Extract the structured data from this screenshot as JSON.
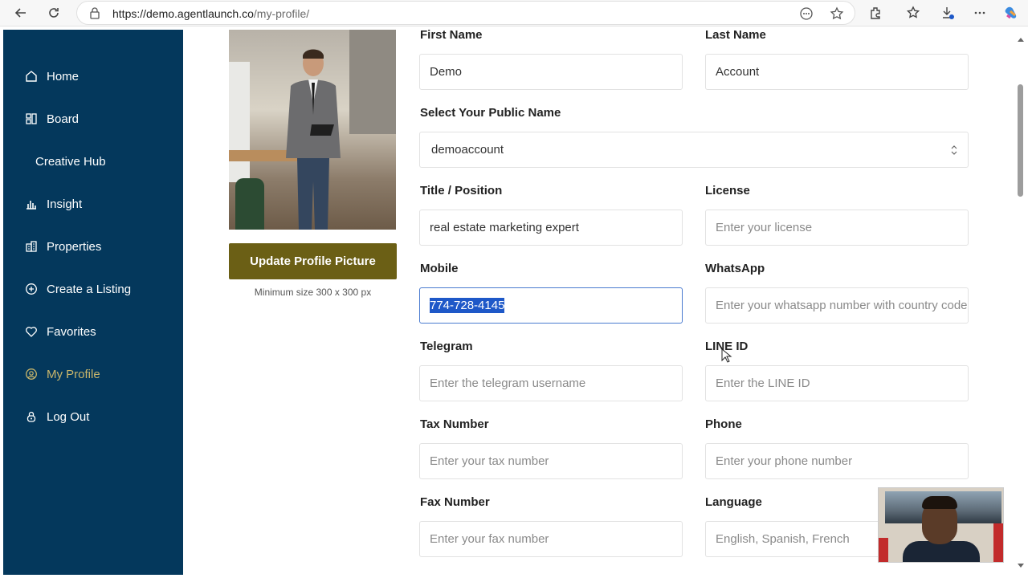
{
  "browser": {
    "url_host": "https://demo.agentlaunch.co",
    "url_path": "/my-profile/"
  },
  "sidebar": {
    "items": [
      {
        "label": "Home",
        "icon": "home-icon"
      },
      {
        "label": "Board",
        "icon": "board-icon"
      },
      {
        "label": "Creative Hub",
        "icon": ""
      },
      {
        "label": "Insight",
        "icon": "chart-icon"
      },
      {
        "label": "Properties",
        "icon": "building-icon"
      },
      {
        "label": "Create a Listing",
        "icon": "plus-circle-icon"
      },
      {
        "label": "Favorites",
        "icon": "heart-icon"
      },
      {
        "label": "My Profile",
        "icon": "user-circle-icon",
        "active": true
      },
      {
        "label": "Log Out",
        "icon": "lock-icon"
      }
    ],
    "active_color": "#c9b66b",
    "background": "#04385c"
  },
  "profile": {
    "update_button": "Update Profile Picture",
    "min_size_note": "Minimum size 300 x 300 px"
  },
  "form": {
    "first_name": {
      "label": "First Name",
      "value": "Demo"
    },
    "last_name": {
      "label": "Last Name",
      "value": "Account"
    },
    "public_name": {
      "label": "Select Your Public Name",
      "value": "demoaccount"
    },
    "title": {
      "label": "Title / Position",
      "value": "real estate marketing expert"
    },
    "license": {
      "label": "License",
      "placeholder": "Enter your license"
    },
    "mobile": {
      "label": "Mobile",
      "value": "774-728-4145"
    },
    "whatsapp": {
      "label": "WhatsApp",
      "placeholder": "Enter your whatsapp number with country code"
    },
    "telegram": {
      "label": "Telegram",
      "placeholder": "Enter the telegram username"
    },
    "line_id": {
      "label": "LINE ID",
      "placeholder": "Enter the LINE ID"
    },
    "tax_number": {
      "label": "Tax Number",
      "placeholder": "Enter your tax number"
    },
    "phone": {
      "label": "Phone",
      "placeholder": "Enter your phone number"
    },
    "fax_number": {
      "label": "Fax Number",
      "placeholder": "Enter your fax number"
    },
    "language": {
      "label": "Language",
      "placeholder": "English, Spanish, French"
    }
  },
  "colors": {
    "button": "#6b5f15",
    "selection": "#1e58c8"
  }
}
